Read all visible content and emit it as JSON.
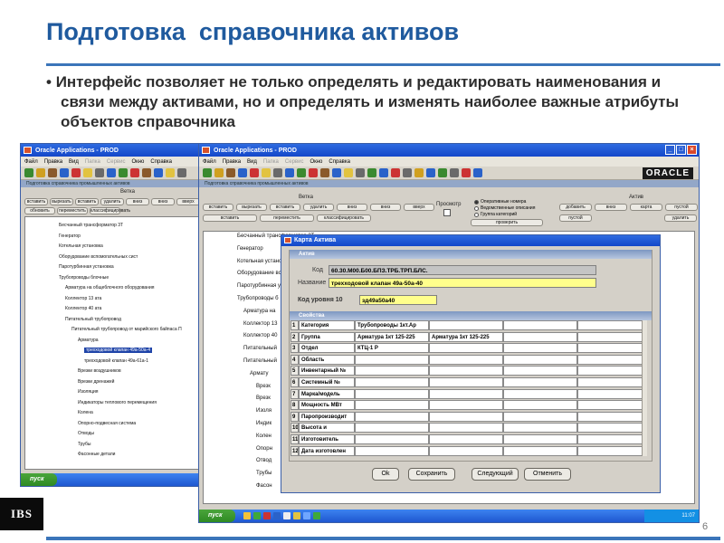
{
  "slide": {
    "title": "Подготовка  справочника активов",
    "bullet": "Интерфейс позволяет не только определять и редактировать наименования и связи между активами, но и определять и изменять наиболее важные атрибуты объектов справочника",
    "logo": "IBS",
    "page_number": "6"
  },
  "back_window": {
    "title": "Oracle Applications - PROD",
    "menu": [
      "Файл",
      "Правка",
      "Вид",
      "Папка",
      "Сервис",
      "Окно",
      "Справка"
    ],
    "form_header": "Подготовка справочника промышленных активов",
    "section": "Ветка",
    "buttons_row1": [
      "вставить",
      "вырезать",
      "вставить",
      "удалить",
      "вниз",
      "вниз",
      "вверх"
    ],
    "buttons_row2": [
      "обновить",
      "переместить",
      "классифицировать"
    ],
    "tree": [
      "Бесчанный трансформатор 3Т",
      "Генератор",
      "Котельная установка",
      "Оборудование вспомогательных сист",
      "Паротурбинная установка",
      "Трубопроводы блочные",
      "Арматура на общеблочного оборудования",
      "Коллектор 13 ата",
      "Коллектор 40 ата",
      "Питательный трубопровод",
      "Питательный трубопровод от марийского байпаса П",
      "Арматура",
      "трехходовой клапан 49а-50а-4",
      "трехходовой клапан 49а-61а-1",
      "Врезки воздушников",
      "Врезки дренажей",
      "Изоляция",
      "Индикаторы теплового перемещения",
      "Колена",
      "Опорно-подвесная система",
      "Отводы",
      "Трубы",
      "Фасонные детали"
    ],
    "taskbar_start": "пуск"
  },
  "front_window": {
    "title": "Oracle Applications - PROD",
    "brand": "ORACLE",
    "menu": [
      "Файл",
      "Правка",
      "Вид",
      "Папка",
      "Сервис",
      "Окно",
      "Справка"
    ],
    "form_header": "Подготовка справочника промышленных активов",
    "section_branch": "Ветка",
    "section_view": "Просмотр",
    "section_active": "Актив",
    "branch_buttons_row1": [
      "вставить",
      "вырезать",
      "вставить",
      "удалить",
      "вниз",
      "вниз",
      "вверх"
    ],
    "branch_buttons_row2": [
      "вставить",
      "переместить",
      "классифицировать"
    ],
    "view_options": [
      "Оперативные номера",
      "Ведомственные описания",
      "Группа категорий"
    ],
    "view_button": "проверить",
    "active_buttons_row1": [
      "добавить",
      "вниз",
      "карта",
      "пустой"
    ],
    "active_buttons_row2": [
      "пустой",
      "удалить"
    ],
    "tree": [
      "Бесчанный трансформатор 3Т",
      "Генератор",
      "Котельная установка",
      "Оборудование вс",
      "Паротурбинная у",
      "Трубопроводы б",
      "Арматура на",
      "Коллектор 13",
      "Коллектор 40",
      "Питательный",
      "Питательный",
      "Армату",
      "Врезк",
      "Врезк",
      "Изоля",
      "Индик",
      "Колен",
      "Опорн",
      "Отвод",
      "Трубы",
      "Фасон"
    ],
    "taskbar_start": "пуск",
    "tray_time": "11:07"
  },
  "dialog": {
    "title": "Карта Актива",
    "section_active": "Актив",
    "code_label": "Код",
    "code_value": "60.30.М00.Б00.БПЗ.ТРБ.ТРП.БЛС.",
    "name_label": "Название",
    "name_value": "трехходовой клапан 49а-50а-40",
    "level_label": "Код уровня 10",
    "level_value": "зд49а50а40",
    "section_props": "Свойства",
    "properties": [
      {
        "n": "1",
        "name": "Категория",
        "v1": "Трубопроводы 1кт.Ар",
        "v2": ""
      },
      {
        "n": "2",
        "name": "Группа",
        "v1": "Арматура 1кт 125-225",
        "v2": "Арматура 1кт 125-225"
      },
      {
        "n": "3",
        "name": "Отдел",
        "v1": "КТЦ-1 Р",
        "v2": ""
      },
      {
        "n": "4",
        "name": "Область",
        "v1": "",
        "v2": ""
      },
      {
        "n": "5",
        "name": "Инвентарный №",
        "v1": "",
        "v2": ""
      },
      {
        "n": "6",
        "name": "Системный №",
        "v1": "",
        "v2": ""
      },
      {
        "n": "7",
        "name": "Марка/модель",
        "v1": "",
        "v2": ""
      },
      {
        "n": "8",
        "name": "Мощность МВт",
        "v1": "",
        "v2": ""
      },
      {
        "n": "9",
        "name": "Паропроизводит",
        "v1": "",
        "v2": ""
      },
      {
        "n": "10",
        "name": "Высота и",
        "v1": "",
        "v2": ""
      },
      {
        "n": "11",
        "name": "Изготовитель",
        "v1": "",
        "v2": ""
      },
      {
        "n": "12",
        "name": "Дата изготовлен",
        "v1": "",
        "v2": ""
      }
    ],
    "buttons": [
      "Ok",
      "Сохранить",
      "Следующий",
      "Отменить"
    ]
  }
}
